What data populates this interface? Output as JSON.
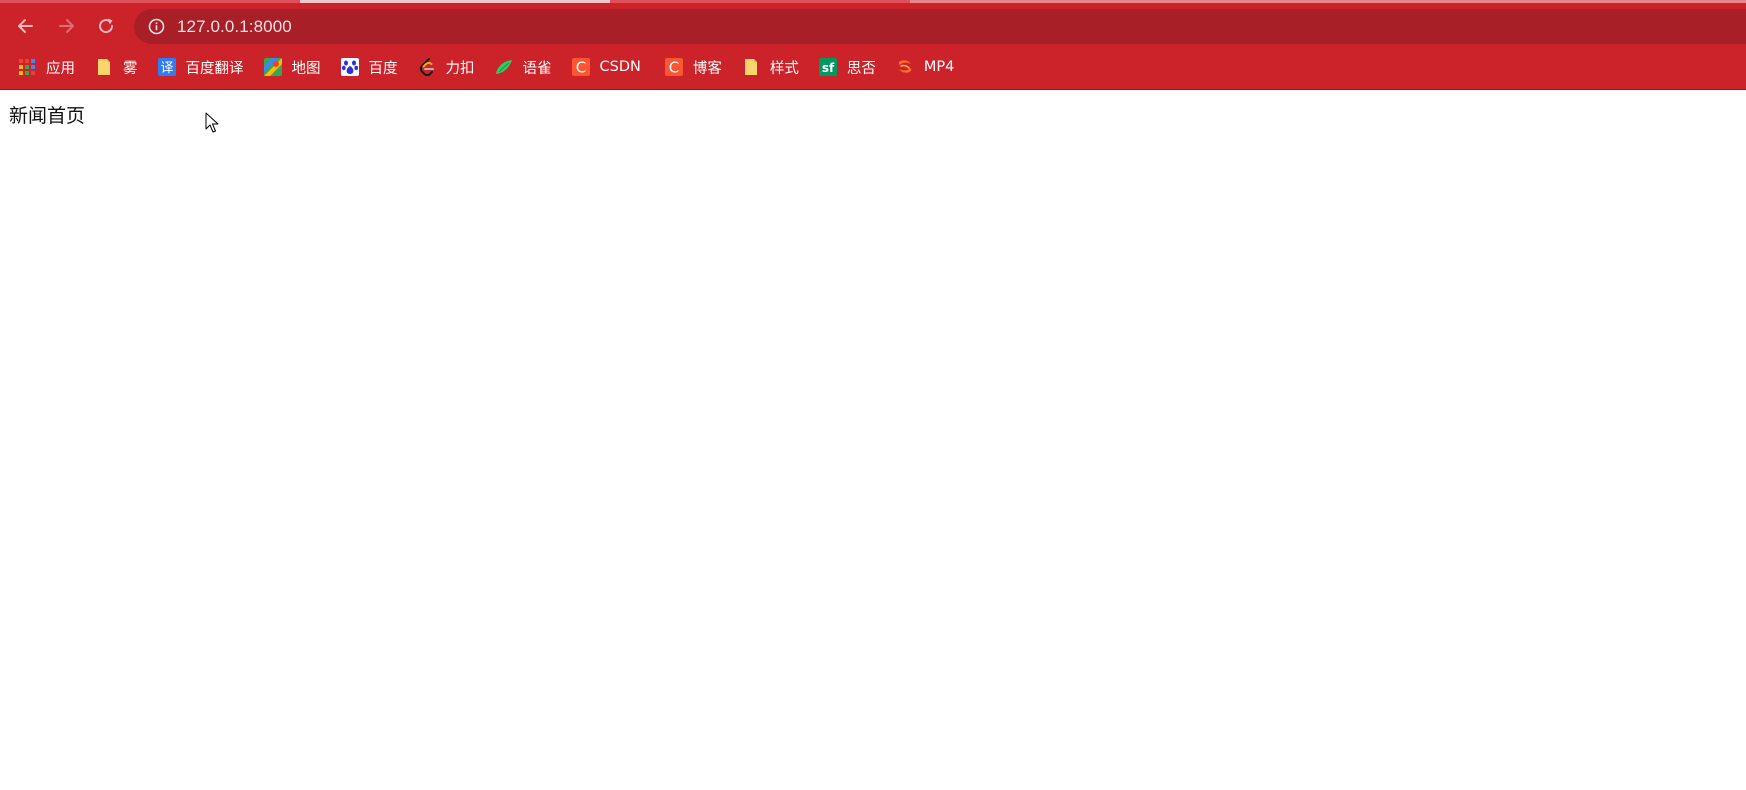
{
  "browser": {
    "url": "127.0.0.1:8000",
    "theme_color": "#cc2229",
    "omnibox_color": "#a81f27",
    "nav": {
      "back_icon": "arrow-left-icon",
      "forward_icon": "arrow-right-icon",
      "reload_icon": "reload-icon",
      "site_info_icon": "info-icon"
    }
  },
  "bookmarks": [
    {
      "label": "应用",
      "icon": "apps-grid-icon"
    },
    {
      "label": "雾",
      "icon": "folder-icon"
    },
    {
      "label": "百度翻译",
      "icon": "translate-icon"
    },
    {
      "label": "地图",
      "icon": "map-icon"
    },
    {
      "label": "百度",
      "icon": "baidu-paw-icon"
    },
    {
      "label": "力扣",
      "icon": "leetcode-icon"
    },
    {
      "label": "语雀",
      "icon": "yuque-icon"
    },
    {
      "label": "CSDN",
      "icon": "csdn-icon"
    },
    {
      "label": "博客",
      "icon": "csdn-icon"
    },
    {
      "label": "样式",
      "icon": "folder-icon"
    },
    {
      "label": "思否",
      "icon": "segmentfault-icon"
    },
    {
      "label": "MP4",
      "icon": "mp4-icon"
    }
  ],
  "page": {
    "heading": "新闻首页"
  }
}
